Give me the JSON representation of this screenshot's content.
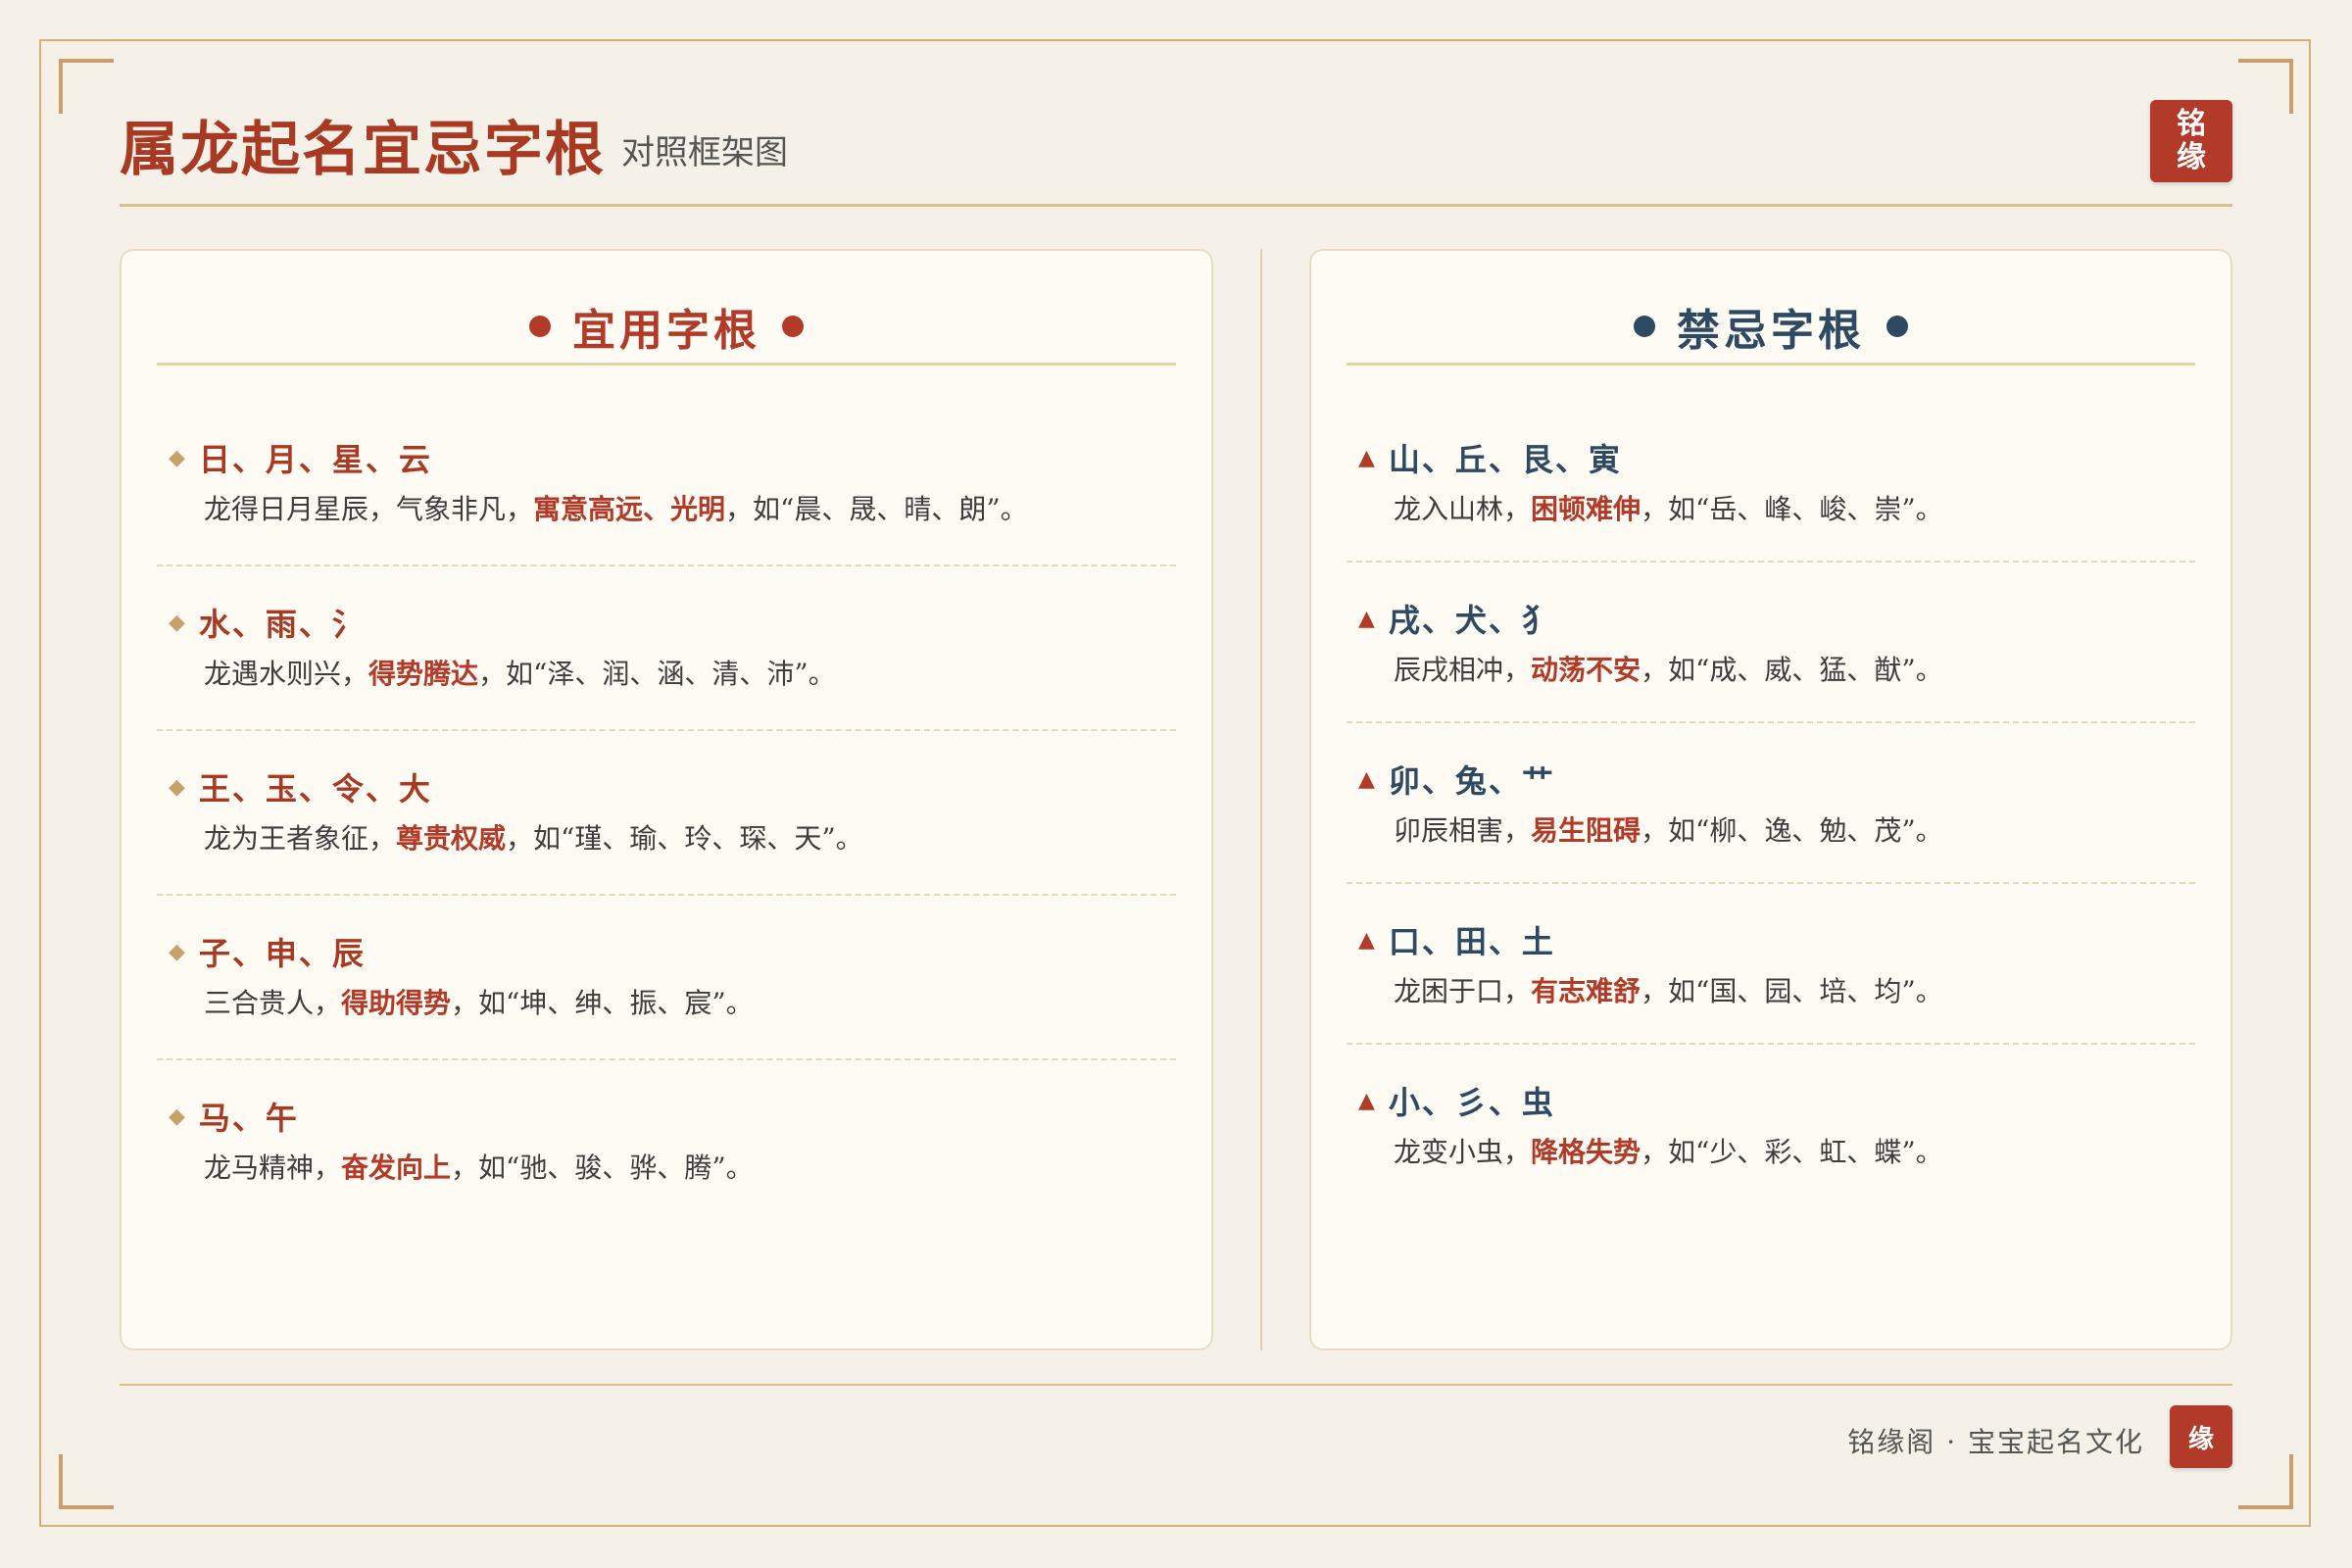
{
  "header": {
    "title": "属龙起名宜忌字根",
    "subtitle": "对照框架图",
    "seal_line1": "铭",
    "seal_line2": "缘"
  },
  "left_panel": {
    "heading": "宜用字根",
    "items": [
      {
        "title": "日、月、星、云",
        "desc_pre": "龙得日月星辰，气象非凡，",
        "highlight": "寓意高远、光明",
        "desc_post": "，如“晨、晟、晴、朗”。"
      },
      {
        "title": "水、雨、氵",
        "desc_pre": "龙遇水则兴，",
        "highlight": "得势腾达",
        "desc_post": "，如“泽、润、涵、清、沛”。"
      },
      {
        "title": "王、玉、令、大",
        "desc_pre": "龙为王者象征，",
        "highlight": "尊贵权威",
        "desc_post": "，如“瑾、瑜、玲、琛、天”。"
      },
      {
        "title": "子、申、辰",
        "desc_pre": "三合贵人，",
        "highlight": "得助得势",
        "desc_post": "，如“坤、绅、振、宸”。"
      },
      {
        "title": "马、午",
        "desc_pre": "龙马精神，",
        "highlight": "奋发向上",
        "desc_post": "，如“驰、骏、骅、腾”。"
      }
    ]
  },
  "right_panel": {
    "heading": "禁忌字根",
    "items": [
      {
        "title": "山、丘、艮、寅",
        "desc_pre": "龙入山林，",
        "highlight": "困顿难伸",
        "desc_post": "，如“岳、峰、峻、崇”。"
      },
      {
        "title": "戌、犬、犭",
        "desc_pre": "辰戌相冲，",
        "highlight": "动荡不安",
        "desc_post": "，如“成、威、猛、猷”。"
      },
      {
        "title": "卯、兔、艹",
        "desc_pre": "卯辰相害，",
        "highlight": "易生阻碍",
        "desc_post": "，如“柳、逸、勉、茂”。"
      },
      {
        "title": "口、田、土",
        "desc_pre": "龙困于口，",
        "highlight": "有志难舒",
        "desc_post": "，如“国、园、培、均”。"
      },
      {
        "title": "小、彡、虫",
        "desc_pre": "龙变小虫，",
        "highlight": "降格失势",
        "desc_post": "，如“少、彩、虹、蝶”。"
      }
    ]
  },
  "footer": {
    "text": "铭缘阁 · 宝宝起名文化",
    "seal": "缘"
  },
  "colors": {
    "background": "#f5f1e8",
    "accent_red": "#b23a28",
    "accent_blue": "#2e4a62",
    "gold": "#d4b07a"
  },
  "icons": {
    "left_marker": "diamond-icon",
    "right_marker": "triangle-icon"
  }
}
